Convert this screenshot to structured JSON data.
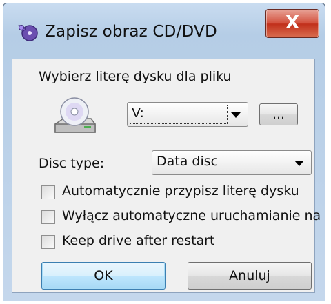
{
  "window": {
    "title": "Zapisz obraz CD/DVD",
    "close_label": "X",
    "icon": "app-disc-icon"
  },
  "drive": {
    "prompt": "Wybierz literę dysku dla pliku",
    "icon": "drive-disc-icon",
    "selected_letter": "V:",
    "browse_label": "..."
  },
  "disc_type": {
    "label": "Disc type:",
    "selected": "Data disc"
  },
  "options": [
    {
      "label": "Automatycznie przypisz literę dysku",
      "checked": false
    },
    {
      "label": "Wyłącz automatyczne uruchamianie na",
      "checked": false
    },
    {
      "label": "Keep drive after restart",
      "checked": false
    }
  ],
  "buttons": {
    "ok": "OK",
    "cancel": "Anuluj"
  },
  "colors": {
    "close_button": "#c1301b",
    "default_button_border": "#3c7fb1",
    "frame": "#b5cde6"
  }
}
